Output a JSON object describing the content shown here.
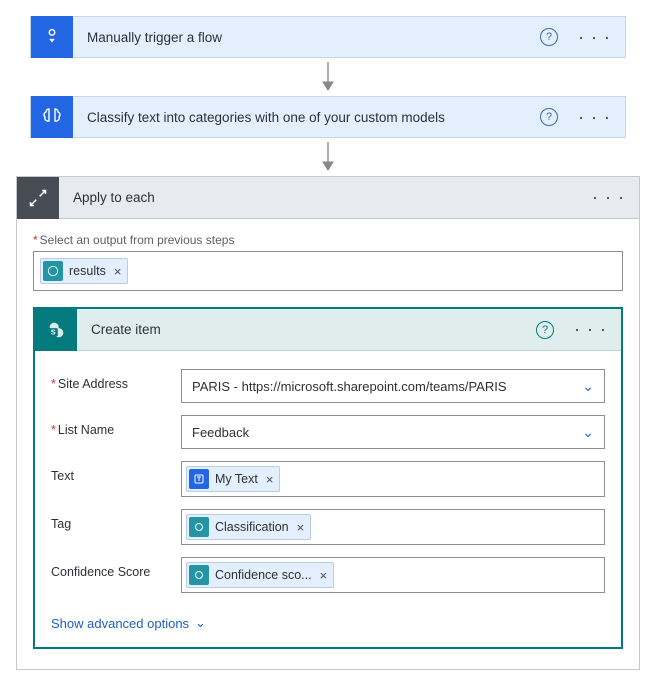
{
  "steps": {
    "trigger": {
      "title": "Manually trigger a flow"
    },
    "classify": {
      "title": "Classify text into categories with one of your custom models"
    },
    "applyEach": {
      "title": "Apply to each"
    }
  },
  "applyEachBody": {
    "selectLabel": "Select an output from previous steps",
    "token": "results"
  },
  "createItem": {
    "title": "Create item",
    "labels": {
      "site": "Site Address",
      "list": "List Name",
      "text": "Text",
      "tag": "Tag",
      "conf": "Confidence Score"
    },
    "values": {
      "site": "PARIS - https://microsoft.sharepoint.com/teams/PARIS",
      "list": "Feedback"
    },
    "tokens": {
      "text": "My Text",
      "tag": "Classification",
      "conf": "Confidence sco..."
    },
    "advanced": "Show advanced options"
  }
}
